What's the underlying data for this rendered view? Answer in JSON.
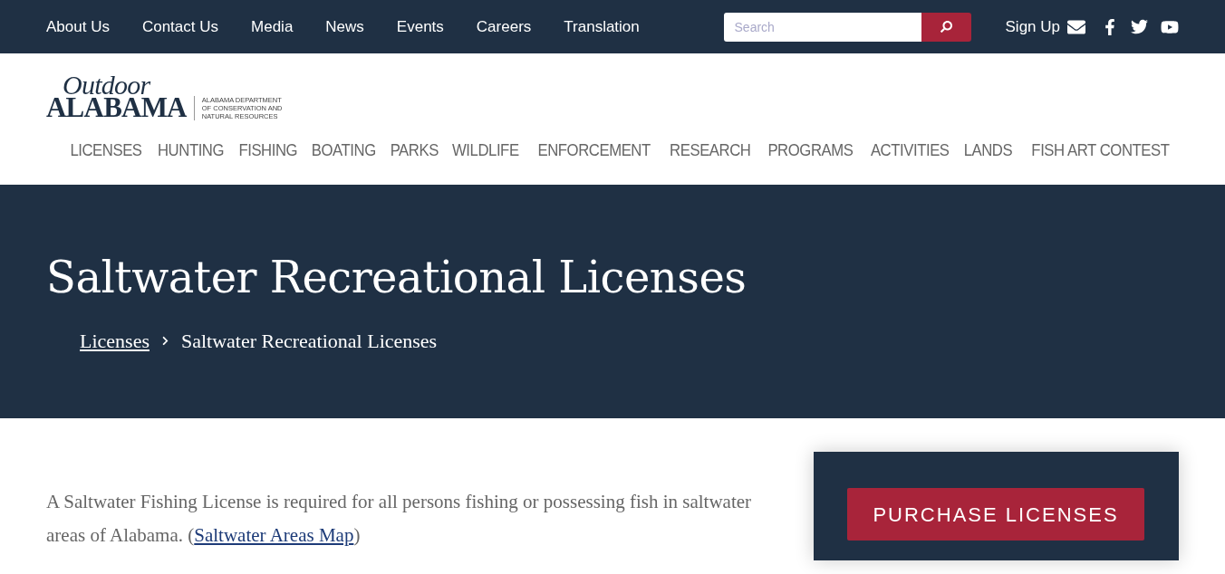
{
  "top_bar": {
    "links": [
      "About Us",
      "Contact Us",
      "Media",
      "News",
      "Events",
      "Careers",
      "Translation"
    ],
    "search": {
      "placeholder": "Search"
    },
    "sign_up": "Sign Up"
  },
  "logo": {
    "line_1": "Outdoor",
    "line_2": "ALABAMA",
    "tagline": [
      "ALABAMA DEPARTMENT",
      "OF CONSERVATION AND",
      "NATURAL RESOURCES"
    ]
  },
  "main_nav": [
    "LICENSES",
    "HUNTING",
    "FISHING",
    "BOATING",
    "PARKS",
    "WILDLIFE",
    "ENFORCEMENT",
    "RESEARCH",
    "PROGRAMS",
    "ACTIVITIES",
    "LANDS",
    "FISH ART CONTEST"
  ],
  "hero": {
    "title": "Saltwater Recreational Licenses",
    "breadcrumb": [
      {
        "label": "Licenses",
        "kind": "link"
      },
      {
        "label": "Saltwater Recreational Licenses",
        "kind": "current"
      }
    ]
  },
  "intro": {
    "text_before": "A Saltwater Fishing License is required for all persons fishing or possessing fish in saltwater areas of Alabama. (",
    "link": "Saltwater Areas Map",
    "text_after": ")"
  },
  "sidebar": {
    "button": "PURCHASE LICENSES"
  }
}
